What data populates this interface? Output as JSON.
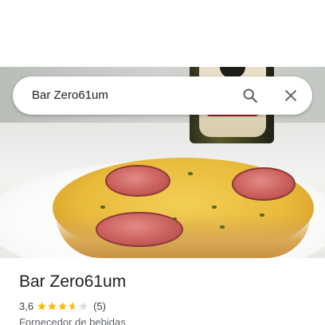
{
  "search": {
    "query": "Bar Zero61um"
  },
  "place": {
    "name": "Bar Zero61um",
    "rating": "3,6",
    "rating_value": 3.6,
    "max_stars": 5,
    "review_count": "(5)",
    "category": "Fornecedor de bebidas"
  },
  "colors": {
    "star_filled": "#fbbc04",
    "star_empty": "#dadce0",
    "icon": "#5f6368",
    "text_primary": "#202124"
  },
  "icons": {
    "search": "search-icon",
    "close": "close-icon",
    "star": "star-icon"
  }
}
